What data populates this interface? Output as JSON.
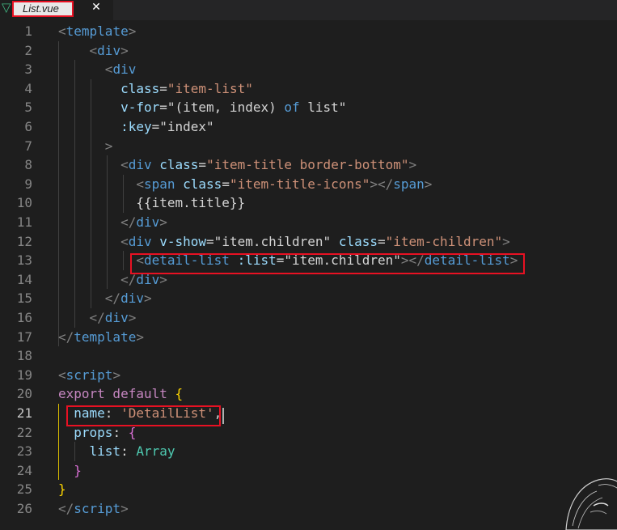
{
  "tab": {
    "title": "List.vue",
    "close_symbol": "✕",
    "icon": "vue-icon"
  },
  "editor": {
    "active_line": 21,
    "lines": [
      {
        "n": "1",
        "tokens": [
          {
            "t": "<",
            "c": "pun"
          },
          {
            "t": "template",
            "c": "tag"
          },
          {
            "t": ">",
            "c": "pun"
          }
        ]
      },
      {
        "n": "2",
        "tokens": [
          {
            "t": "    "
          },
          {
            "t": "<",
            "c": "pun"
          },
          {
            "t": "div",
            "c": "tag"
          },
          {
            "t": ">",
            "c": "pun"
          }
        ]
      },
      {
        "n": "3",
        "tokens": [
          {
            "t": "      "
          },
          {
            "t": "<",
            "c": "pun"
          },
          {
            "t": "div",
            "c": "tag"
          }
        ]
      },
      {
        "n": "4",
        "tokens": [
          {
            "t": "        "
          },
          {
            "t": "class",
            "c": "attr"
          },
          {
            "t": "=",
            "c": "def"
          },
          {
            "t": "\"item-list\"",
            "c": "str"
          }
        ]
      },
      {
        "n": "5",
        "tokens": [
          {
            "t": "        "
          },
          {
            "t": "v-for",
            "c": "attr"
          },
          {
            "t": "=\"(item, index) ",
            "c": "def"
          },
          {
            "t": "of",
            "c": "tag"
          },
          {
            "t": " list\"",
            "c": "def"
          }
        ]
      },
      {
        "n": "6",
        "tokens": [
          {
            "t": "        "
          },
          {
            "t": ":key",
            "c": "attr"
          },
          {
            "t": "=\"index\"",
            "c": "def"
          }
        ]
      },
      {
        "n": "7",
        "tokens": [
          {
            "t": "      "
          },
          {
            "t": ">",
            "c": "pun"
          }
        ]
      },
      {
        "n": "8",
        "tokens": [
          {
            "t": "        "
          },
          {
            "t": "<",
            "c": "pun"
          },
          {
            "t": "div",
            "c": "tag"
          },
          {
            "t": " "
          },
          {
            "t": "class",
            "c": "attr"
          },
          {
            "t": "=",
            "c": "def"
          },
          {
            "t": "\"item-title border-bottom\"",
            "c": "str"
          },
          {
            "t": ">",
            "c": "pun"
          }
        ]
      },
      {
        "n": "9",
        "tokens": [
          {
            "t": "          "
          },
          {
            "t": "<",
            "c": "pun"
          },
          {
            "t": "span",
            "c": "tag"
          },
          {
            "t": " "
          },
          {
            "t": "class",
            "c": "attr"
          },
          {
            "t": "=",
            "c": "def"
          },
          {
            "t": "\"item-title-icons\"",
            "c": "str"
          },
          {
            "t": "></",
            "c": "pun"
          },
          {
            "t": "span",
            "c": "tag"
          },
          {
            "t": ">",
            "c": "pun"
          }
        ]
      },
      {
        "n": "10",
        "tokens": [
          {
            "t": "          {{item.title}}",
            "c": "def"
          }
        ]
      },
      {
        "n": "11",
        "tokens": [
          {
            "t": "        "
          },
          {
            "t": "</",
            "c": "pun"
          },
          {
            "t": "div",
            "c": "tag"
          },
          {
            "t": ">",
            "c": "pun"
          }
        ]
      },
      {
        "n": "12",
        "tokens": [
          {
            "t": "        "
          },
          {
            "t": "<",
            "c": "pun"
          },
          {
            "t": "div",
            "c": "tag"
          },
          {
            "t": " "
          },
          {
            "t": "v-show",
            "c": "attr"
          },
          {
            "t": "=\"item.children\" ",
            "c": "def"
          },
          {
            "t": "class",
            "c": "attr"
          },
          {
            "t": "=",
            "c": "def"
          },
          {
            "t": "\"item-children\"",
            "c": "str"
          },
          {
            "t": ">",
            "c": "pun"
          }
        ]
      },
      {
        "n": "13",
        "tokens": [
          {
            "t": "          "
          },
          {
            "t": "<",
            "c": "pun"
          },
          {
            "t": "detail-list",
            "c": "tag"
          },
          {
            "t": " "
          },
          {
            "t": ":list",
            "c": "attr"
          },
          {
            "t": "=\"item.children\"",
            "c": "def"
          },
          {
            "t": "></",
            "c": "pun"
          },
          {
            "t": "detail-list",
            "c": "tag"
          },
          {
            "t": ">",
            "c": "pun"
          }
        ]
      },
      {
        "n": "14",
        "tokens": [
          {
            "t": "        "
          },
          {
            "t": "</",
            "c": "pun"
          },
          {
            "t": "div",
            "c": "tag"
          },
          {
            "t": ">",
            "c": "pun"
          }
        ]
      },
      {
        "n": "15",
        "tokens": [
          {
            "t": "      "
          },
          {
            "t": "</",
            "c": "pun"
          },
          {
            "t": "div",
            "c": "tag"
          },
          {
            "t": ">",
            "c": "pun"
          }
        ]
      },
      {
        "n": "16",
        "tokens": [
          {
            "t": "    "
          },
          {
            "t": "</",
            "c": "pun"
          },
          {
            "t": "div",
            "c": "tag"
          },
          {
            "t": ">",
            "c": "pun"
          }
        ]
      },
      {
        "n": "17",
        "tokens": [
          {
            "t": "</",
            "c": "pun"
          },
          {
            "t": "template",
            "c": "tag"
          },
          {
            "t": ">",
            "c": "pun"
          }
        ]
      },
      {
        "n": "18",
        "tokens": []
      },
      {
        "n": "19",
        "tokens": [
          {
            "t": "<",
            "c": "pun"
          },
          {
            "t": "script",
            "c": "tag"
          },
          {
            "t": ">",
            "c": "pun"
          }
        ]
      },
      {
        "n": "20",
        "tokens": [
          {
            "t": "export default",
            "c": "kw"
          },
          {
            "t": " "
          },
          {
            "t": "{",
            "c": "br1"
          }
        ]
      },
      {
        "n": "21",
        "tokens": [
          {
            "t": "  "
          },
          {
            "t": "name",
            "c": "attr"
          },
          {
            "t": ": ",
            "c": "def"
          },
          {
            "t": "'DetailList'",
            "c": "str"
          },
          {
            "t": ",",
            "c": "def"
          }
        ]
      },
      {
        "n": "22",
        "tokens": [
          {
            "t": "  "
          },
          {
            "t": "props",
            "c": "attr"
          },
          {
            "t": ": ",
            "c": "def"
          },
          {
            "t": "{",
            "c": "br2"
          }
        ]
      },
      {
        "n": "23",
        "tokens": [
          {
            "t": "    "
          },
          {
            "t": "list",
            "c": "attr"
          },
          {
            "t": ": ",
            "c": "def"
          },
          {
            "t": "Array",
            "c": "ty"
          }
        ]
      },
      {
        "n": "24",
        "tokens": [
          {
            "t": "  "
          },
          {
            "t": "}",
            "c": "br2"
          }
        ]
      },
      {
        "n": "25",
        "tokens": [
          {
            "t": "}",
            "c": "br1"
          }
        ]
      },
      {
        "n": "26",
        "tokens": [
          {
            "t": "</",
            "c": "pun"
          },
          {
            "t": "script",
            "c": "tag"
          },
          {
            "t": ">",
            "c": "pun"
          }
        ]
      }
    ]
  }
}
